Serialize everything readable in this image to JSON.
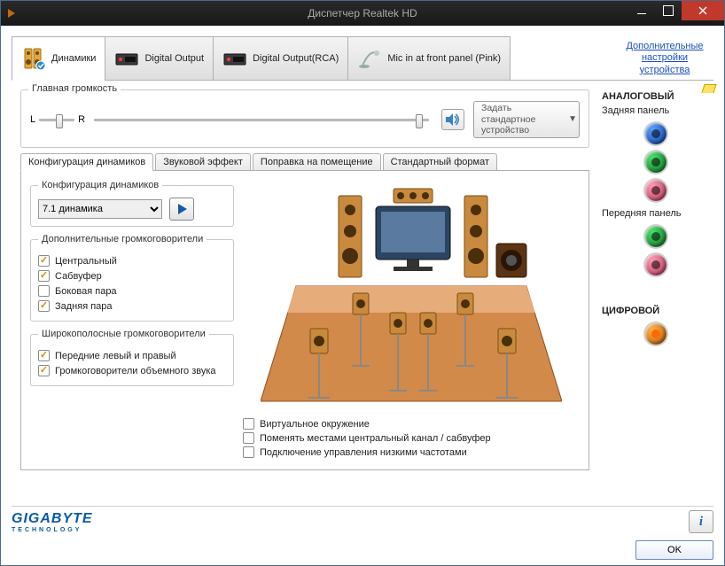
{
  "window": {
    "title": "Диспетчер Realtek HD"
  },
  "device_tabs": {
    "speakers": "Динамики",
    "digital_output": "Digital Output",
    "digital_output_rca": "Digital Output(RCA)",
    "mic_in": "Mic in at front panel (Pink)"
  },
  "extra_link": "Дополнительные настройки устройства",
  "master_volume": {
    "group_label": "Главная громкость",
    "left_label": "L",
    "right_label": "R",
    "set_default": "Задать стандартное устройство"
  },
  "inner_tabs": {
    "config": "Конфигурация динамиков",
    "effect": "Звуковой эффект",
    "room": "Поправка на помещение",
    "format": "Стандартный формат"
  },
  "config": {
    "group_label": "Конфигурация динамиков",
    "selected": "7.1 динамика",
    "extra_speakers": {
      "group_label": "Дополнительные громкоговорители",
      "center": "Центральный",
      "sub": "Сабвуфер",
      "side": "Боковая пара",
      "rear": "Задняя пара"
    },
    "fullrange": {
      "group_label": "Широкополосные громкоговорители",
      "front": "Передние левый и правый",
      "surround": "Громкоговорители объемного звука"
    },
    "bottom": {
      "virtual": "Виртуальное окружение",
      "swap": "Поменять местами центральный канал / сабвуфер",
      "bass": "Подключение управления низкими частотами"
    }
  },
  "side_panel": {
    "analog": "АНАЛОГОВЫЙ",
    "rear_panel": "Задняя панель",
    "front_panel": "Передняя панель",
    "digital": "ЦИФРОВОЙ"
  },
  "footer": {
    "brand": "GIGABYTE",
    "brand_sub": "TECHNOLOGY",
    "ok": "OK"
  }
}
